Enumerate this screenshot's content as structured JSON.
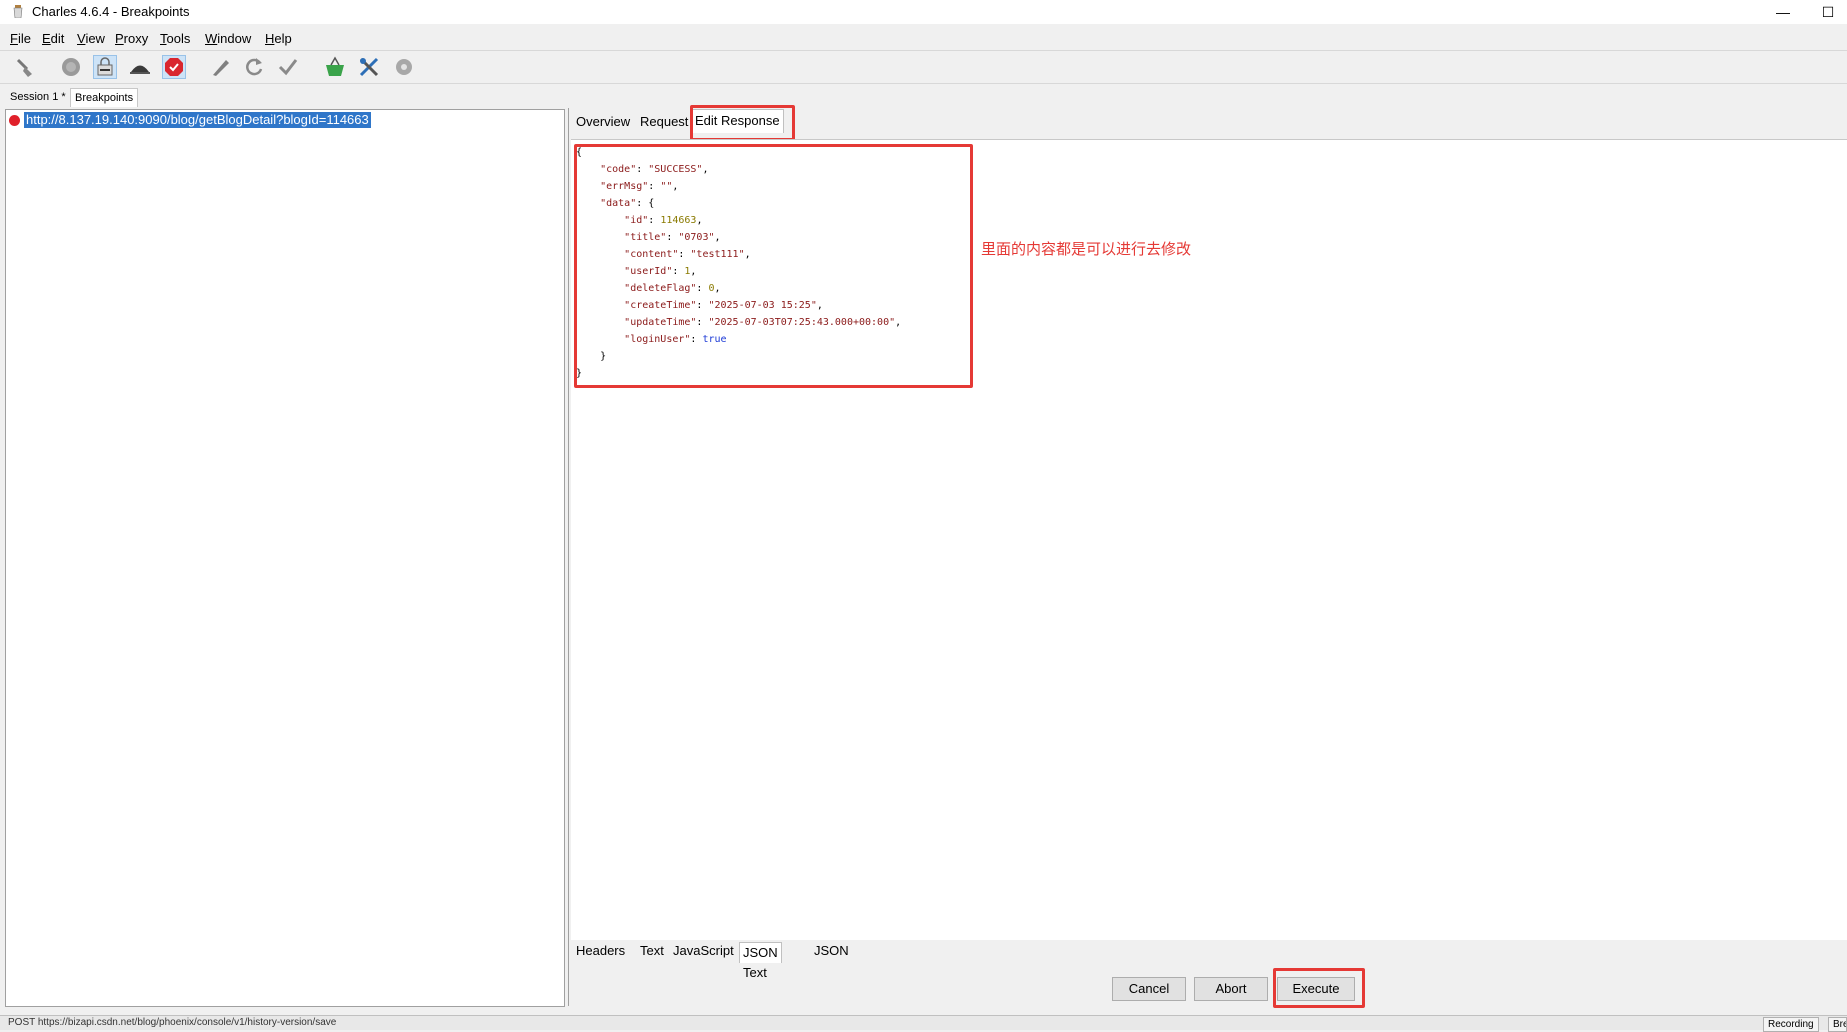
{
  "window": {
    "title": "Charles 4.6.4 - Breakpoints",
    "minimize": "—",
    "maximize": "☐"
  },
  "menu": [
    {
      "label": "File",
      "u": "F",
      "rest": "ile"
    },
    {
      "label": "Edit",
      "u": "E",
      "rest": "dit"
    },
    {
      "label": "View",
      "u": "V",
      "rest": "iew"
    },
    {
      "label": "Proxy",
      "u": "P",
      "rest": "roxy"
    },
    {
      "label": "Tools",
      "u": "T",
      "rest": "ools"
    },
    {
      "label": "Window",
      "u": "W",
      "rest": "indow"
    },
    {
      "label": "Help",
      "u": "H",
      "rest": "elp"
    }
  ],
  "toolbar_icons": [
    "broom-icon",
    "record-icon",
    "ssl-proxy-icon",
    "throttle-icon",
    "breakpoints-icon",
    "pen-icon",
    "repeat-icon",
    "validate-icon",
    "basket-icon",
    "tools-icon",
    "settings-icon"
  ],
  "session_tabs": {
    "session": "Session 1 *",
    "breakpoints": "Breakpoints"
  },
  "request": {
    "url": "http://8.137.19.140:9090/blog/getBlogDetail?blogId=114663"
  },
  "tabs": {
    "overview": "Overview",
    "request": "Request",
    "edit_response": "Edit Response"
  },
  "json": {
    "open": "{",
    "code_key": "\"code\"",
    "code_val": "\"SUCCESS\"",
    "errmsg_key": "\"errMsg\"",
    "errmsg_val": "\"\"",
    "data_key": "\"data\"",
    "id_key": "\"id\"",
    "id_val": "114663",
    "title_key": "\"title\"",
    "title_val": "\"0703\"",
    "content_key": "\"content\"",
    "content_val": "\"test111\"",
    "userid_key": "\"userId\"",
    "userid_val": "1",
    "deleteflag_key": "\"deleteFlag\"",
    "deleteflag_val": "0",
    "createtime_key": "\"createTime\"",
    "createtime_val": "\"2025-07-03 15:25\"",
    "updatetime_key": "\"updateTime\"",
    "updatetime_val": "\"2025-07-03T07:25:43.000+00:00\"",
    "loginuser_key": "\"loginUser\"",
    "loginuser_val": "true",
    "inner_close": "}",
    "close": "}"
  },
  "annotation": "里面的内容都是可以进行去修改",
  "sub_tabs": {
    "headers": "Headers",
    "text": "Text",
    "javascript": "JavaScript",
    "json_text": "JSON Text",
    "json": "JSON"
  },
  "buttons": {
    "cancel": "Cancel",
    "abort": "Abort",
    "execute": "Execute"
  },
  "status": {
    "text": "POST https://bizapi.csdn.net/blog/phoenix/console/v1/history-version/save",
    "recording": "Recording",
    "breakpoints": "Bre"
  },
  "colors": {
    "annotation": "#e53935",
    "selection": "#2f76c9"
  }
}
